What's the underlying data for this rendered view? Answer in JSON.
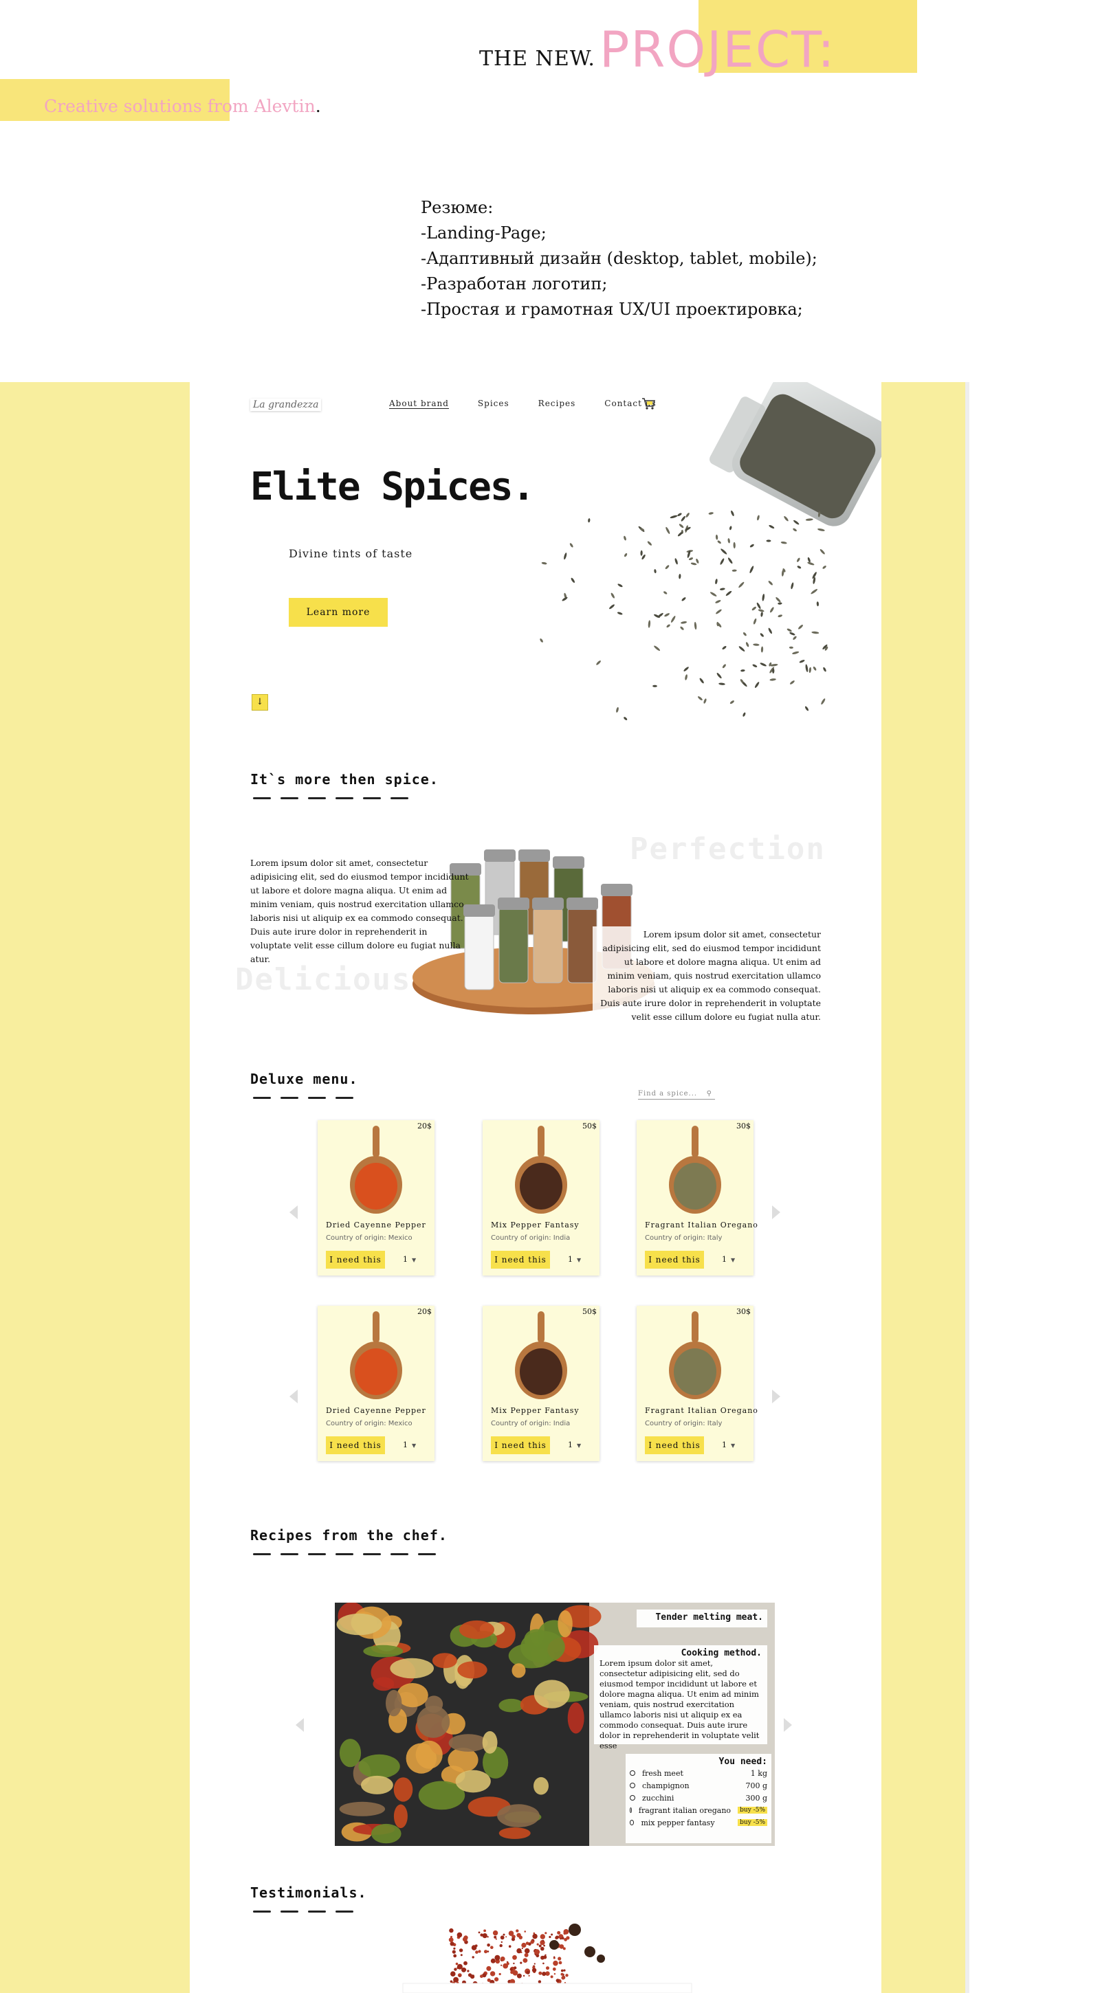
{
  "presentation": {
    "intro": "THE NEW.",
    "project": "PROJECT:",
    "creative_prefix": "Creative solutions from",
    "creative_name": "Alevtin",
    "creative_dot": ".",
    "summary": [
      "Резюме:",
      "-Landing-Page;",
      "-Адаптивный дизайн (desktop, tablet, mobile);",
      "-Разработан логотип;",
      "-Простая и грамотная UX/UI проектировка;"
    ]
  },
  "site": {
    "logo": "La grandezza",
    "nav": [
      "About brand",
      "Spices",
      "Recipes",
      "Contact us"
    ],
    "hero": {
      "title": "Elite Spices.",
      "subtitle": "Divine tints of taste",
      "button": "Learn more",
      "scroll_icon": "↓"
    },
    "about": {
      "title": "It`s more then spice.",
      "ghost_1": "Perfection",
      "ghost_2": "Delicious",
      "text_1": "Lorem ipsum dolor sit amet, consectetur adipisicing elit, sed do eiusmod tempor incididunt ut labore et dolore magna aliqua. Ut enim ad minim veniam, quis nostrud exercitation ullamco laboris nisi ut aliquip ex ea commodo consequat. Duis aute irure dolor in reprehenderit in voluptate velit esse cillum dolore eu fugiat nulla atur.",
      "text_2": "Lorem ipsum dolor sit amet, consectetur adipisicing elit, sed do eiusmod tempor incididunt ut labore et dolore magna aliqua. Ut enim ad minim veniam, quis nostrud exercitation ullamco laboris nisi ut aliquip ex ea commodo consequat. Duis aute irure dolor in reprehenderit in voluptate velit esse cillum dolore eu fugiat nulla atur."
    },
    "menu": {
      "title": "Deluxe menu.",
      "search_placeholder": "Find a spice...",
      "products": [
        {
          "price": "20$",
          "name": "Dried Cayenne Pepper",
          "origin": "Country of origin: Mexico",
          "button": "I need this",
          "qty": "1",
          "color": "#d9501e"
        },
        {
          "price": "50$",
          "name": "Mix Pepper Fantasy",
          "origin": "Country of origin: India",
          "button": "I need this",
          "qty": "1",
          "color": "#4a2a1c"
        },
        {
          "price": "30$",
          "name": "Fragrant Italian Oregano",
          "origin": "Country of origin: Italy",
          "button": "I need this",
          "qty": "1",
          "color": "#7d7a52"
        },
        {
          "price": "20$",
          "name": "Dried Cayenne Pepper",
          "origin": "Country of origin: Mexico",
          "button": "I need this",
          "qty": "1",
          "color": "#d9501e"
        },
        {
          "price": "50$",
          "name": "Mix Pepper Fantasy",
          "origin": "Country of origin: India",
          "button": "I need this",
          "qty": "1",
          "color": "#4a2a1c"
        },
        {
          "price": "30$",
          "name": "Fragrant Italian Oregano",
          "origin": "Country of origin: Italy",
          "button": "I need this",
          "qty": "1",
          "color": "#7d7a52"
        }
      ]
    },
    "recipes": {
      "title": "Recipes from the chef.",
      "dish": "Tender melting meat.",
      "method_title": "Cooking method.",
      "method": "Lorem ipsum dolor sit amet, consectetur adipisicing elit, sed do eiusmod tempor incididunt ut labore et dolore magna aliqua. Ut enim ad minim veniam, quis nostrud exercitation ullamco laboris nisi ut aliquip ex ea commodo consequat. Duis aute irure dolor in reprehenderit in voluptate velit esse",
      "need_title": "You need:",
      "ingredients": [
        {
          "name": "fresh meet",
          "qty": "1 kg",
          "buy": ""
        },
        {
          "name": "champignon",
          "qty": "700 g",
          "buy": ""
        },
        {
          "name": "zucchini",
          "qty": "300 g",
          "buy": ""
        },
        {
          "name": "fragrant italian oregano",
          "qty": "",
          "buy": "buy -5%"
        },
        {
          "name": "mix pepper fantasy",
          "qty": "",
          "buy": "buy -5%"
        }
      ]
    },
    "testimonials": {
      "title": "Testimonials."
    }
  },
  "colors": {
    "yellow_accent": "#f7e04b",
    "side_bg": "#f8ee9e",
    "pink": "#f2a5c2"
  }
}
